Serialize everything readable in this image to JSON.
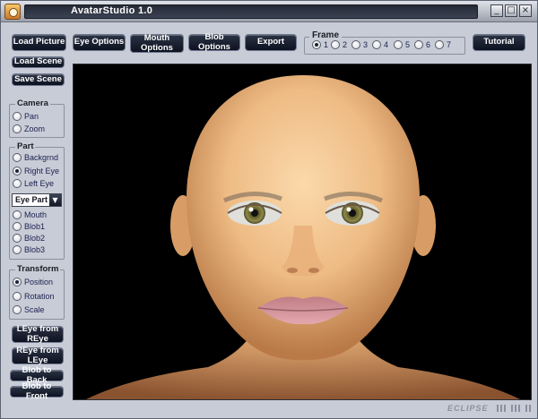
{
  "window": {
    "title": "AvatarStudio 1.0",
    "controls": [
      "_",
      "□",
      "×"
    ]
  },
  "toolbar": {
    "load_picture": "Load Picture",
    "eye_options": "Eye Options",
    "mouth_options": "Mouth Options",
    "blob_options": "Blob Options",
    "export": "Export",
    "tutorial": "Tutorial"
  },
  "frame": {
    "legend": "Frame",
    "options": [
      "1",
      "2",
      "3",
      "4",
      "5",
      "6",
      "7"
    ],
    "selected": "1"
  },
  "left": {
    "load_scene": "Load Scene",
    "save_scene": "Save Scene",
    "camera": {
      "legend": "Camera",
      "pan": "Pan",
      "zoom": "Zoom"
    },
    "part": {
      "legend": "Part",
      "backgrnd": "Backgrnd",
      "right_eye": "Right Eye",
      "left_eye": "Left Eye",
      "dropdown_value": "Eye Part",
      "mouth": "Mouth",
      "blob1": "Blob1",
      "blob2": "Blob2",
      "blob3": "Blob3",
      "selected": "Right Eye"
    },
    "transform": {
      "legend": "Transform",
      "position": "Position",
      "rotation": "Rotation",
      "scale": "Scale",
      "selected": "Position"
    },
    "leye_from_reye": "LEye from REye",
    "reye_from_leye": "REye from LEye",
    "blob_to_back": "Blob to Back",
    "blob_to_front": "Blob to Front"
  },
  "footer": {
    "brand": "ECLIPSE"
  },
  "colors": {
    "panel": "#c8ccd6",
    "button_dark": "#0d1220",
    "viewport": "#000000",
    "skin": "#f0c08c"
  }
}
